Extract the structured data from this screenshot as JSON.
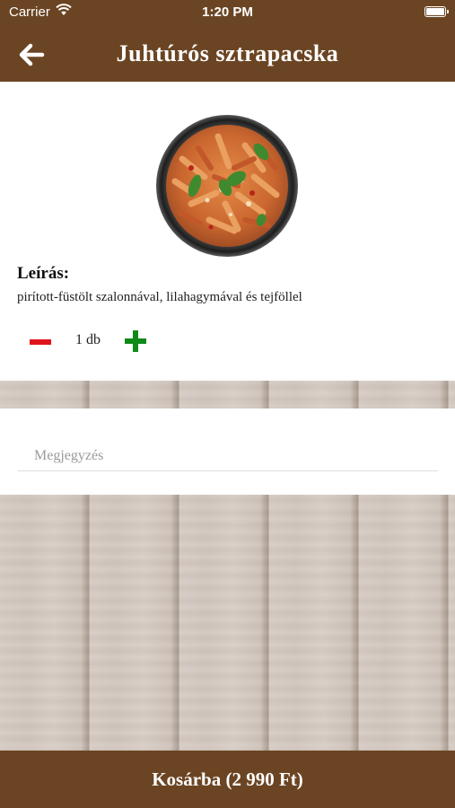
{
  "status_bar": {
    "carrier": "Carrier",
    "time": "1:20 PM"
  },
  "nav": {
    "title": "Juhtúrós sztrapacska",
    "back_icon": "arrow-left-icon"
  },
  "product": {
    "description_heading": "Leírás:",
    "description": "pirított-füstölt szalonnával, lilahagymával és tejföllel",
    "quantity_label": "1 db",
    "minus_icon": "minus-icon",
    "plus_icon": "plus-icon"
  },
  "note": {
    "placeholder": "Megjegyzés",
    "value": ""
  },
  "cart": {
    "button_label": "Kosárba (2 990 Ft)"
  },
  "colors": {
    "brand_brown": "#6b4523",
    "minus_red": "#e0141b",
    "plus_green": "#0f8a17"
  }
}
